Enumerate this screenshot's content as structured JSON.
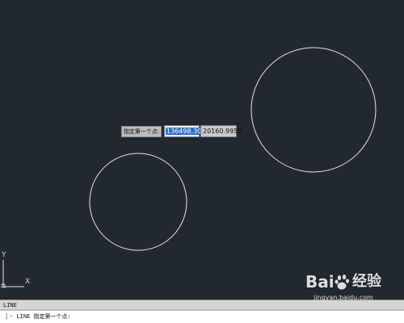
{
  "drawing": {
    "background": "#212830",
    "stroke_color": "#e6e6e6",
    "circles": [
      {
        "name": "large-circle"
      },
      {
        "name": "small-circle"
      }
    ]
  },
  "dynamic_input": {
    "prompt_label": "指定第一个点:",
    "x_value": "136498.302",
    "y_value": "20160.9953"
  },
  "ucs_icon": {
    "x_label": "X",
    "y_label": "Y"
  },
  "command_area": {
    "history_text": "LINE",
    "command_line_text": "- LINE 指定第一个点:"
  },
  "watermark": {
    "logo_left": "Bai",
    "logo_right": "经验",
    "url": "jingyan.baidu.com"
  }
}
